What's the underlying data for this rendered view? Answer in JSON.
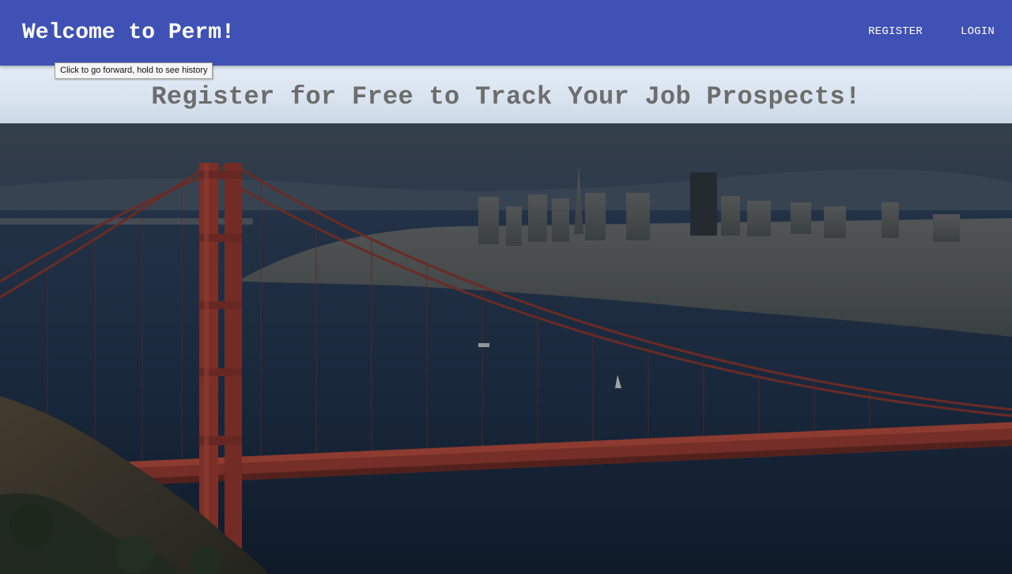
{
  "navbar": {
    "brand": "Welcome to Perm!",
    "links": [
      {
        "label": "REGISTER"
      },
      {
        "label": "LOGIN"
      }
    ]
  },
  "tooltip": {
    "text": "Click to go forward, hold to see history"
  },
  "banner": {
    "headline": "Register for Free to Track Your Job Prospects!"
  },
  "hero": {
    "image": "golden-gate-bridge-san-francisco-photo"
  },
  "colors": {
    "navbar_bg": "#3f51b5",
    "nav_text": "#ffffff",
    "banner_bg": "#dce6f1",
    "headline_text": "#6d6d6d",
    "bridge_red": "#a8392a",
    "water": "#1d2d44"
  }
}
